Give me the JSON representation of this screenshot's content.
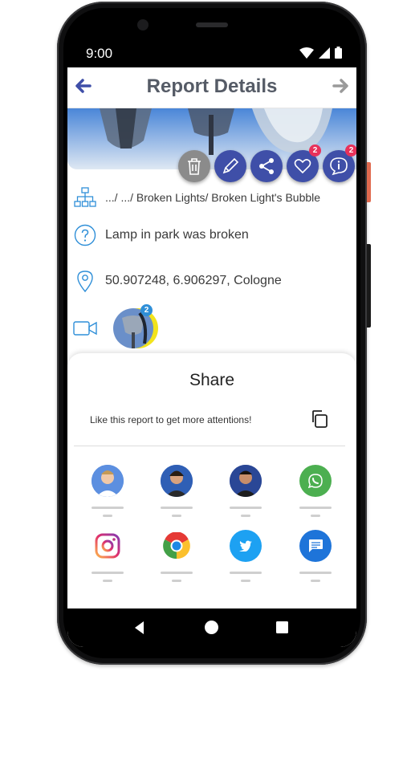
{
  "status_bar": {
    "time": "9:00"
  },
  "app_bar": {
    "title": "Report Details"
  },
  "actions": {
    "like_count": "2",
    "comment_count": "2"
  },
  "details": {
    "category": ".../ .../ Broken Lights/ Broken Light's Bubble",
    "description": "Lamp in park was broken",
    "location": "50.907248, 6.906297, Cologne",
    "media_count": "2"
  },
  "share": {
    "title": "Share",
    "subtitle": "Like this report to get more attentions!",
    "targets": [
      "contact-1",
      "contact-2",
      "contact-3",
      "whatsapp",
      "instagram",
      "chrome",
      "twitter",
      "messages"
    ]
  },
  "colors": {
    "primary": "#3f4fa8",
    "badge": "#e8315a",
    "icon_blue": "#2f8fd8"
  }
}
